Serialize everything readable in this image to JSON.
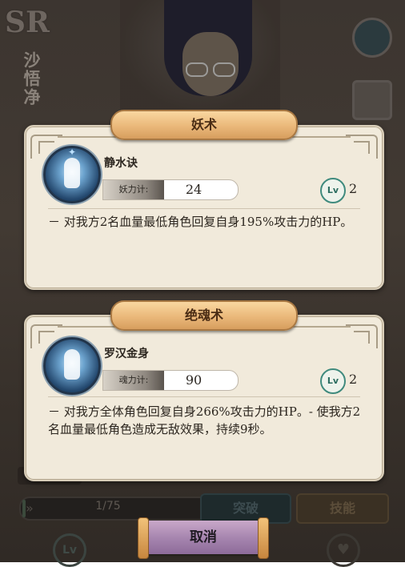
{
  "background": {
    "rank_badge": "SR",
    "character_name": "沙悟净",
    "progress_text": "1/75",
    "progress_fraction": 0.013,
    "breakthrough_label": "突破",
    "skill_label": "技能",
    "lv_icon_label": "Lv"
  },
  "panels": [
    {
      "title": "妖术",
      "skill_name": "静水诀",
      "stat_label": "妖力计:",
      "stat_value": "24",
      "level_badge": "Lv",
      "level": "2",
      "description": "－ 对我方2名血量最低角色回复自身195%攻击力的HP。",
      "icon": "meditating-figure-icon"
    },
    {
      "title": "绝魂术",
      "skill_name": "罗汉金身",
      "stat_label": "魂力计:",
      "stat_value": "90",
      "level_badge": "Lv",
      "level": "2",
      "description": "－ 对我方全体角色回复自身266%攻击力的HP。- 使我方2名血量最低角色造成无敌效果，持续9秒。",
      "icon": "golden-body-figure-icon"
    }
  ],
  "cancel_label": "取消"
}
